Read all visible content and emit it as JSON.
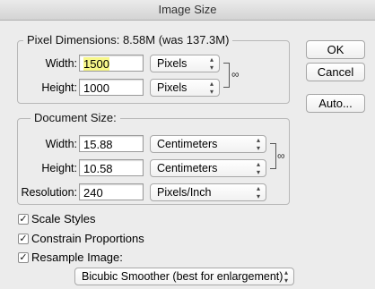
{
  "window": {
    "title": "Image Size"
  },
  "pixel_dimensions": {
    "legend": "Pixel Dimensions:",
    "size_value": "8.58M (was 137.3M)",
    "width_label": "Width:",
    "width_value": "1500",
    "width_unit": "Pixels",
    "height_label": "Height:",
    "height_value": "1000",
    "height_unit": "Pixels"
  },
  "document_size": {
    "legend": "Document Size:",
    "width_label": "Width:",
    "width_value": "15.88",
    "width_unit": "Centimeters",
    "height_label": "Height:",
    "height_value": "10.58",
    "height_unit": "Centimeters",
    "resolution_label": "Resolution:",
    "resolution_value": "240",
    "resolution_unit": "Pixels/Inch"
  },
  "buttons": {
    "ok": "OK",
    "cancel": "Cancel",
    "auto": "Auto..."
  },
  "options": {
    "scale_styles": {
      "label": "Scale Styles",
      "checked": true
    },
    "constrain_proportions": {
      "label": "Constrain Proportions",
      "checked": true
    },
    "resample_image": {
      "label": "Resample Image:",
      "checked": true
    }
  },
  "resample_method": "Bicubic Smoother (best for enlargement)",
  "icons": {
    "chain": "chain-link-icon",
    "dropdown": "updown-caret-icon",
    "check": "checkmark-icon"
  },
  "colors": {
    "highlight": "#f7f78a"
  }
}
